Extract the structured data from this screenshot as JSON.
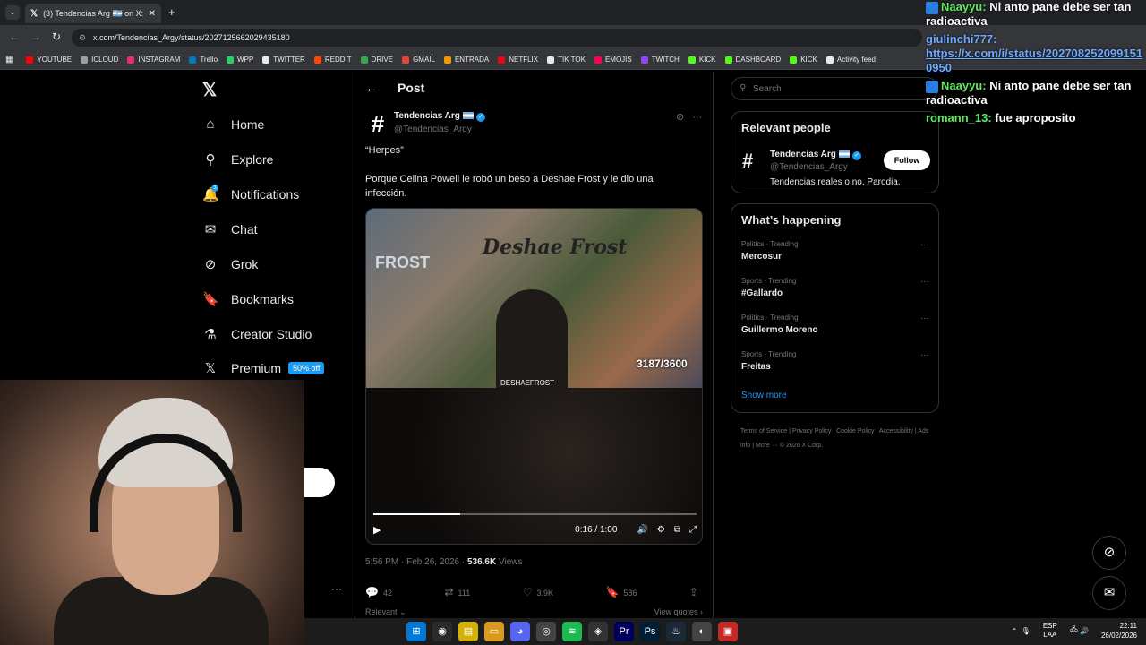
{
  "browser": {
    "tab_title": "(3) Tendencias Arg 🇦🇷 on X: \"\"H",
    "url": "x.com/Tendencias_Argy/status/2027125662029435180",
    "bookmarks": [
      {
        "label": "YOUTUBE",
        "color": "#ff0000"
      },
      {
        "label": "ICLOUD",
        "color": "#9aa0a6"
      },
      {
        "label": "INSTAGRAM",
        "color": "#e1306c"
      },
      {
        "label": "Trello",
        "color": "#0079bf"
      },
      {
        "label": "WPP",
        "color": "#25d366"
      },
      {
        "label": "TWITTER",
        "color": "#e7e9ea"
      },
      {
        "label": "REDDIT",
        "color": "#ff4500"
      },
      {
        "label": "DRIVE",
        "color": "#34a853"
      },
      {
        "label": "GMAIL",
        "color": "#ea4335"
      },
      {
        "label": "ENTRADA",
        "color": "#f29900"
      },
      {
        "label": "NETFLIX",
        "color": "#e50914"
      },
      {
        "label": "TIK TOK",
        "color": "#e7e9ea"
      },
      {
        "label": "EMOJIS",
        "color": "#ff0050"
      },
      {
        "label": "TWITCH",
        "color": "#9146ff"
      },
      {
        "label": "KICK",
        "color": "#53fc18"
      },
      {
        "label": "DASHBOARD",
        "color": "#53fc18"
      },
      {
        "label": "KICK",
        "color": "#53fc18"
      },
      {
        "label": "Activity feed",
        "color": "#e7e9ea"
      }
    ]
  },
  "sidebar": {
    "items": [
      {
        "label": "Home",
        "icon": "home-icon",
        "glyph": "⌂"
      },
      {
        "label": "Explore",
        "icon": "search-icon",
        "glyph": "⚲"
      },
      {
        "label": "Notifications",
        "icon": "bell-icon",
        "glyph": "🔔"
      },
      {
        "label": "Chat",
        "icon": "mail-icon",
        "glyph": "✉"
      },
      {
        "label": "Grok",
        "icon": "grok-icon",
        "glyph": "⊘"
      },
      {
        "label": "Bookmarks",
        "icon": "bookmark-icon",
        "glyph": "🔖"
      },
      {
        "label": "Creator Studio",
        "icon": "flask-icon",
        "glyph": "⚗"
      },
      {
        "label": "Premium",
        "icon": "x-icon",
        "glyph": "𝕏"
      }
    ],
    "premium_badge": "50% off",
    "notif_count": "3"
  },
  "post": {
    "header": "Post",
    "author_name": "Tendencias Arg",
    "author_handle": "@Tendencias_Argy",
    "text_line1": "“Herpes”",
    "text_line2": "Porque Celina Powell le robó un beso a Deshae Frost y le dio una infección.",
    "media_banner": "Deshae Frost",
    "media_frost": "FROST",
    "media_counter": "3187/3600",
    "media_handle": "DESHAEFROST",
    "video_time": "0:16 / 1:00",
    "video_progress": 0.27,
    "timestamp": "5:56 PM · Feb 26, 2026 · ",
    "views_count": "536.6K",
    "views_label": " Views",
    "replies": "42",
    "reposts": "111",
    "likes": "3.9K",
    "bookmarks": "586",
    "relevant": "Relevant ⌄",
    "view_quotes": "View quotes ›"
  },
  "right": {
    "search_placeholder": "Search",
    "relevant_title": "Relevant people",
    "rp_name": "Tendencias Arg",
    "rp_handle": "@Tendencias_Argy",
    "rp_bio": "Tendencias reales o no. Parodia.",
    "follow_label": "Follow",
    "happening_title": "What’s happening",
    "trends": [
      {
        "context": "Politics · Trending",
        "topic": "Mercosur"
      },
      {
        "context": "Sports · Trending",
        "topic": "#Gallardo"
      },
      {
        "context": "Politics · Trending",
        "topic": "Guillermo Moreno"
      },
      {
        "context": "Sports · Trending",
        "topic": "Freitas"
      }
    ],
    "show_more": "Show more",
    "footer": "Terms of Service  |  Privacy Policy  |  Cookie Policy  |  Accessibility  |  Ads info  |  More ···  © 2026 X Corp."
  },
  "chat": [
    {
      "user": "Naayyu:",
      "msg": " Ni anto pane debe ser tan radioactiva",
      "user_color": "#5fe85f"
    },
    {
      "user": "giulinchi777:",
      "msg": "https://x.com/i/status/2027082520991510950",
      "user_color": "#6fa8ff",
      "is_link": true
    },
    {
      "user": "Naayyu:",
      "msg": " Ni anto pane debe ser tan radioactiva",
      "user_color": "#5fe85f"
    },
    {
      "user": "romann_13:",
      "msg": " fue aproposito",
      "user_color": "#5fe85f"
    }
  ],
  "taskbar": {
    "lang_top": "ESP",
    "lang_bottom": "LAA",
    "time": "22:11",
    "date": "26/02/2026"
  }
}
